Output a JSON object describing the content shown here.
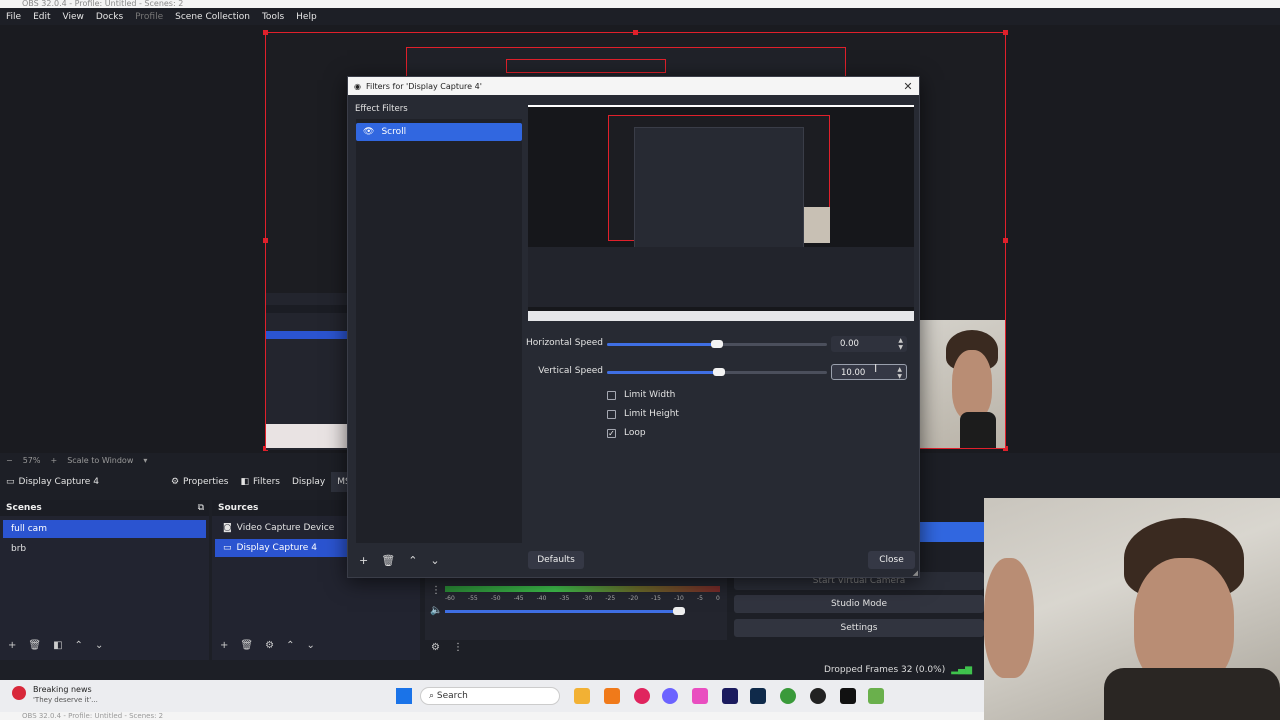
{
  "window": {
    "title": "OBS 32.0.4 - Profile: Untitled - Scenes: 2"
  },
  "menu": [
    "File",
    "Edit",
    "View",
    "Docks",
    "Profile",
    "Scene Collection",
    "Tools",
    "Help"
  ],
  "preview": {
    "zoom": "57%",
    "zoom_plus": "+",
    "zoom_minus": "−",
    "scale_mode": "Scale to Window"
  },
  "source_toolbar": {
    "source_name": "Display Capture 4",
    "properties": "Properties",
    "filters": "Filters",
    "display": "Display",
    "display_value": "MSI M"
  },
  "scenes": {
    "header": "Scenes",
    "items": [
      "full cam",
      "brb"
    ],
    "selected": 0
  },
  "sources": {
    "header": "Sources",
    "items": [
      "Video Capture Device",
      "Display Capture 4"
    ],
    "selected": 1
  },
  "mixer": {
    "ticks": [
      "-60",
      "-55",
      "-50",
      "-45",
      "-40",
      "-35",
      "-30",
      "-25",
      "-20",
      "-15",
      "-10",
      "-5",
      "0"
    ]
  },
  "controls": {
    "start_virtual_camera": "Start Virtual Camera",
    "studio_mode": "Studio Mode",
    "settings": "Settings"
  },
  "statusbar": {
    "dropped_frames": "Dropped Frames 32 (0.0%)"
  },
  "taskbar": {
    "news_title": "Breaking news",
    "news_sub": "'They deserve it'...",
    "search": "Search"
  },
  "dialog": {
    "title": "Filters for 'Display Capture 4'",
    "close_glyph": "✕",
    "effect_filters_label": "Effect Filters",
    "filters": [
      {
        "name": "Scroll",
        "visible": true
      }
    ],
    "horizontal_speed_label": "Horizontal Speed",
    "horizontal_speed_value": "0.00",
    "horizontal_speed_level": 0.5,
    "vertical_speed_label": "Vertical Speed",
    "vertical_speed_value": "10.00",
    "vertical_speed_level": 0.51,
    "limit_width_label": "Limit Width",
    "limit_width_checked": false,
    "limit_height_label": "Limit Height",
    "limit_height_checked": false,
    "loop_label": "Loop",
    "loop_checked": true,
    "defaults_button": "Defaults",
    "close_button": "Close"
  },
  "colors": {
    "accent": "#2b54d0",
    "selection": "#3167e0",
    "red_border": "#e0202b"
  }
}
